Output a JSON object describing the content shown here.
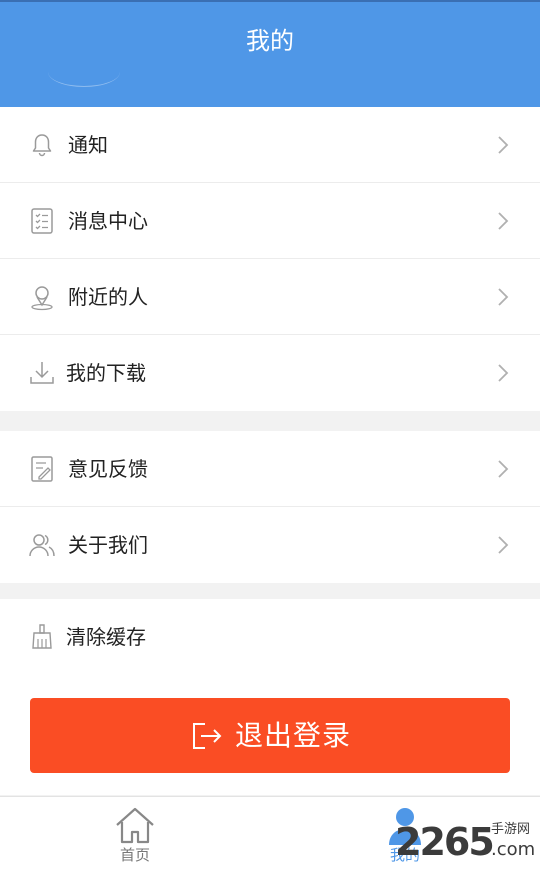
{
  "header": {
    "title": "我的"
  },
  "group1": {
    "items": [
      {
        "label": "通知",
        "icon": "bell-icon"
      },
      {
        "label": "消息中心",
        "icon": "checklist-icon"
      },
      {
        "label": "附近的人",
        "icon": "location-person-icon"
      },
      {
        "label": "我的下载",
        "icon": "download-icon"
      }
    ]
  },
  "group2": {
    "items": [
      {
        "label": "意见反馈",
        "icon": "feedback-icon"
      },
      {
        "label": "关于我们",
        "icon": "people-icon"
      }
    ]
  },
  "group3": {
    "items": [
      {
        "label": "清除缓存",
        "icon": "broom-icon"
      }
    ]
  },
  "logout": {
    "label": "退出登录",
    "icon": "logout-icon"
  },
  "tabbar": {
    "tabs": [
      {
        "label": "首页",
        "icon": "home-icon",
        "active": false
      },
      {
        "label": "我的",
        "icon": "user-icon",
        "active": true
      }
    ]
  },
  "watermark": {
    "number": "2265",
    "cn": "手游网",
    "com": ".com"
  },
  "colors": {
    "header_bg": "#4f97e7",
    "accent": "#4f97e7",
    "logout_bg": "#fa4d24",
    "icon_gray": "#9a9a9a",
    "page_bg": "#f2f2f2"
  }
}
